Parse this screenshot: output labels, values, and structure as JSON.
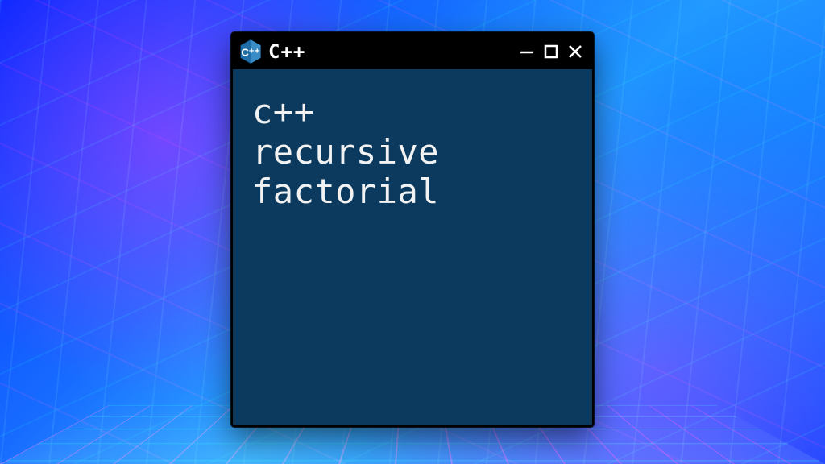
{
  "window": {
    "title": "C++",
    "logo_name": "cpp-logo",
    "controls": {
      "minimize": "minimize",
      "maximize": "maximize",
      "close": "close"
    }
  },
  "content": {
    "line1": "c++",
    "line2": "recursive",
    "line3": "factorial"
  },
  "colors": {
    "window_bg": "#0b3a5e",
    "titlebar_bg": "#000000",
    "text": "#f2f2f2"
  }
}
